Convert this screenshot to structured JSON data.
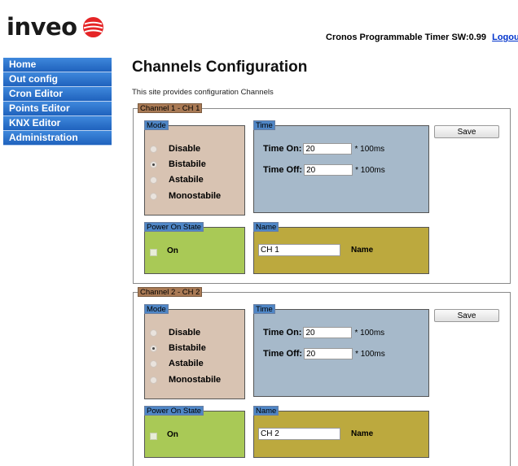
{
  "brand": {
    "logo_text": "inveo",
    "logo_icon": "inveo-sphere-logo",
    "accent": "#e52426"
  },
  "header": {
    "info": "Cronos Programmable Timer SW:0.99",
    "logout": "Logout"
  },
  "sidebar": {
    "items": [
      {
        "label": "Home"
      },
      {
        "label": "Out config"
      },
      {
        "label": "Cron Editor"
      },
      {
        "label": "Points Editor"
      },
      {
        "label": "KNX Editor"
      },
      {
        "label": "Administration"
      }
    ]
  },
  "page": {
    "title": "Channels Configuration",
    "description": "This site provides configuration Channels"
  },
  "channels": [
    {
      "legend": "Channel 1 - CH 1",
      "mode_legend": "Mode",
      "modes": [
        "Disable",
        "Bistabile",
        "Astabile",
        "Monostabile"
      ],
      "selected_mode": "Bistabile",
      "time_legend": "Time",
      "time_on_label": "Time On:",
      "time_on_value": "20",
      "time_off_label": "Time Off:",
      "time_off_value": "20",
      "time_unit": "* 100ms",
      "save_label": "Save",
      "power_legend": "Power On State",
      "power_on_label": "On",
      "power_on_checked": false,
      "name_legend": "Name",
      "name_value": "CH 1",
      "name_label": "Name"
    },
    {
      "legend": "Channel 2 - CH 2",
      "mode_legend": "Mode",
      "modes": [
        "Disable",
        "Bistabile",
        "Astabile",
        "Monostabile"
      ],
      "selected_mode": "Bistabile",
      "time_legend": "Time",
      "time_on_label": "Time On:",
      "time_on_value": "20",
      "time_off_label": "Time Off:",
      "time_off_value": "20",
      "time_unit": "* 100ms",
      "save_label": "Save",
      "power_legend": "Power On State",
      "power_on_label": "On",
      "power_on_checked": false,
      "name_legend": "Name",
      "name_value": "CH 2",
      "name_label": "Name"
    }
  ]
}
